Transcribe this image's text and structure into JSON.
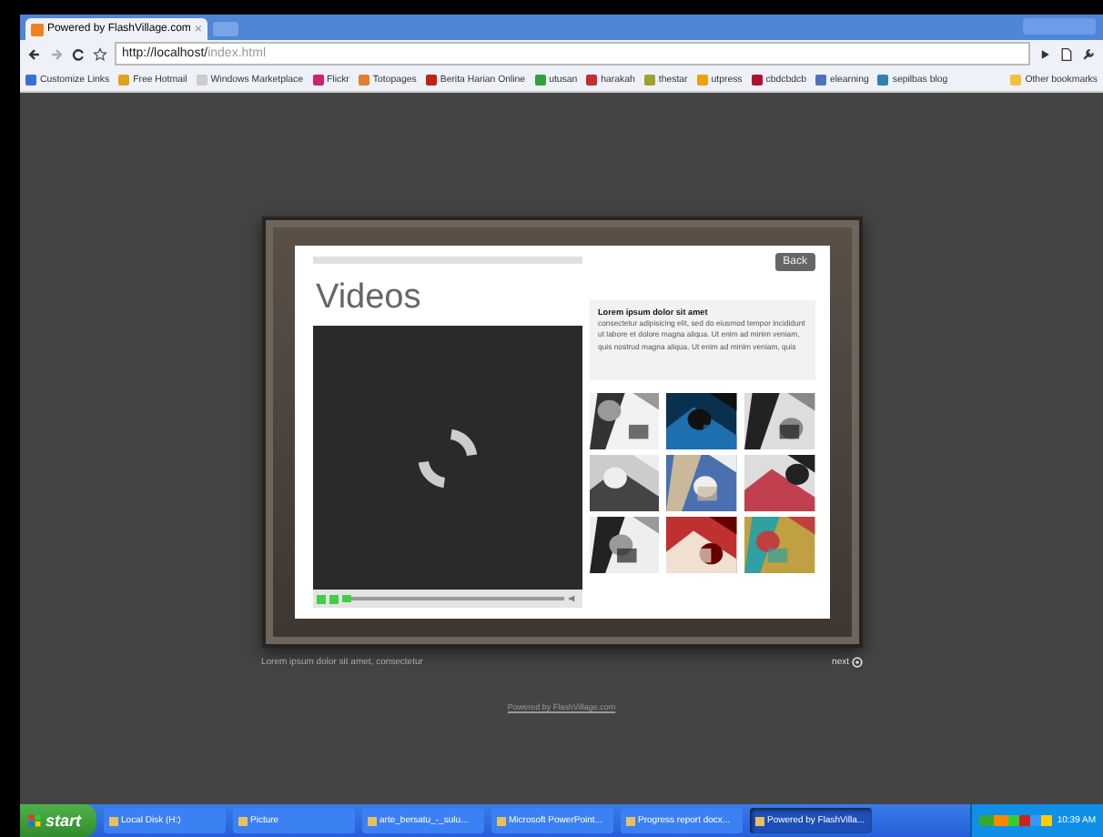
{
  "browser": {
    "tab": {
      "title": "Powered by FlashVillage.com",
      "close": "×"
    },
    "url": {
      "host": "http://localhost/",
      "path": "index.html"
    },
    "bookmarks": [
      {
        "label": "Customize Links",
        "color": "#3a6fd8"
      },
      {
        "label": "Free Hotmail",
        "color": "#e0a020"
      },
      {
        "label": "Windows Marketplace",
        "color": "#cccccc"
      },
      {
        "label": "Flickr",
        "color": "#d02070"
      },
      {
        "label": "Totopages",
        "color": "#e08030"
      },
      {
        "label": "Berita Harian Online",
        "color": "#c02020"
      },
      {
        "label": "utusan",
        "color": "#30a040"
      },
      {
        "label": "harakah",
        "color": "#c03030"
      },
      {
        "label": "thestar",
        "color": "#a0a030"
      },
      {
        "label": "utpress",
        "color": "#f0a000"
      },
      {
        "label": "cbdcbdcb",
        "color": "#b01030"
      },
      {
        "label": "elearning",
        "color": "#5070c0"
      },
      {
        "label": "sepilbas blog",
        "color": "#3080b0"
      }
    ],
    "other_bookmarks": "Other bookmarks"
  },
  "gallery": {
    "title": "Videos",
    "back": "Back",
    "info": {
      "heading": "Lorem ipsum dolor sit amet",
      "body": "consectetur adipisicing elit, sed do eiusmod tempor incididunt ut labore et dolore magna aliqua. Ut enim ad minim veniam, quis nostrud magna aliqua. Ut enim ad minim veniam, quis"
    },
    "caption": "Lorem ipsum dolor sit amet, consectetur",
    "next": "next"
  },
  "footer": {
    "link": "Powered by FlashVillage.com"
  },
  "taskbar": {
    "start": "start",
    "items": [
      {
        "label": "Local Disk (H:)",
        "selected": false
      },
      {
        "label": "Picture",
        "selected": false
      },
      {
        "label": "arte_bersatu_-_sulu...",
        "selected": false
      },
      {
        "label": "Microsoft PowerPoint...",
        "selected": false
      },
      {
        "label": "Progress report docx...",
        "selected": false
      },
      {
        "label": "Powered by FlashVilla...",
        "selected": true
      }
    ],
    "clock": "10:39 AM"
  }
}
